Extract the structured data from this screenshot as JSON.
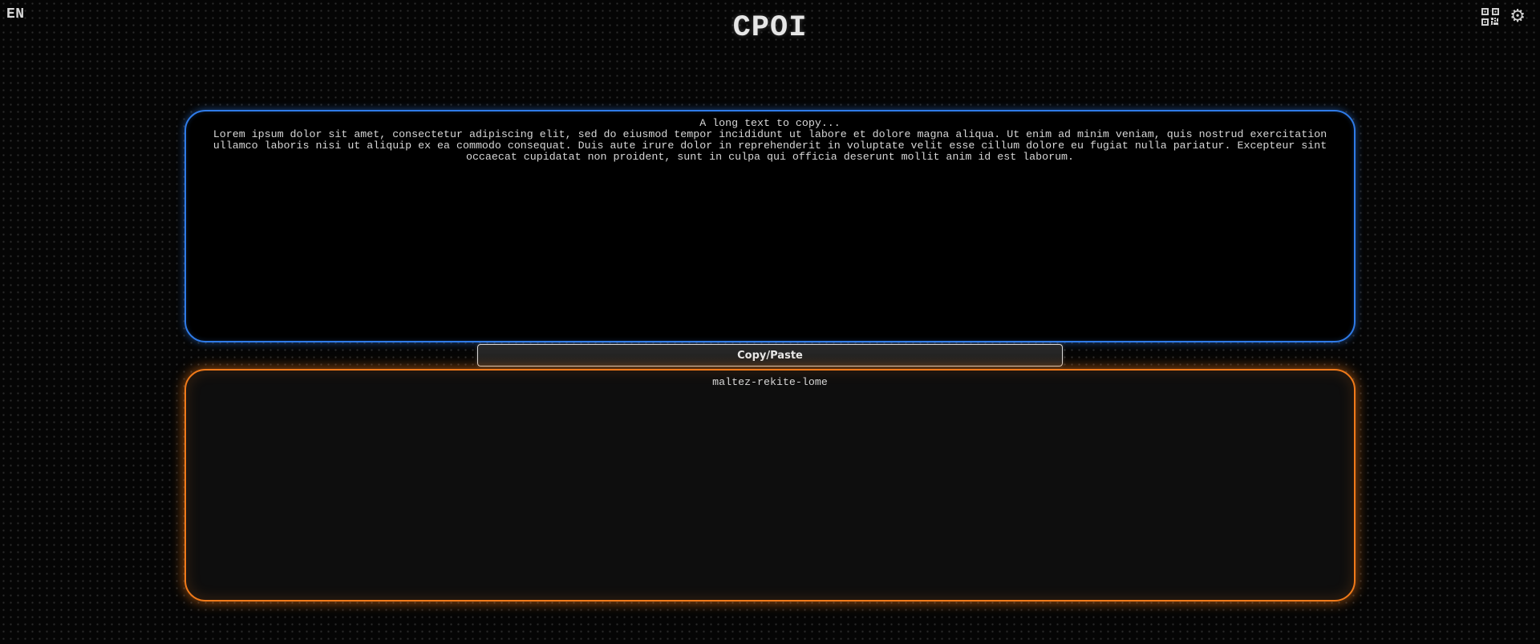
{
  "header": {
    "language": "EN",
    "title": "CPOI",
    "icons": [
      "qr-code-icon",
      "gear-icon"
    ]
  },
  "input_panel": {
    "placeholder": "A long text to copy...",
    "text": "Lorem ipsum dolor sit amet, consectetur adipiscing elit, sed do eiusmod tempor incididunt ut labore et dolore magna aliqua. Ut enim ad minim veniam, quis nostrud exercitation ullamco laboris nisi ut aliquip ex ea commodo consequat. Duis aute irure dolor in reprehenderit in voluptate velit esse cillum dolore eu fugiat nulla pariatur. Excepteur sint occaecat cupidatat non proident, sunt in culpa qui officia deserunt mollit anim id est laborum.",
    "border_color": "#2f7be8"
  },
  "action": {
    "copy_paste_label": "Copy/Paste"
  },
  "output_panel": {
    "code": "maltez-rekite-lome",
    "border_color": "#f07a1a"
  }
}
